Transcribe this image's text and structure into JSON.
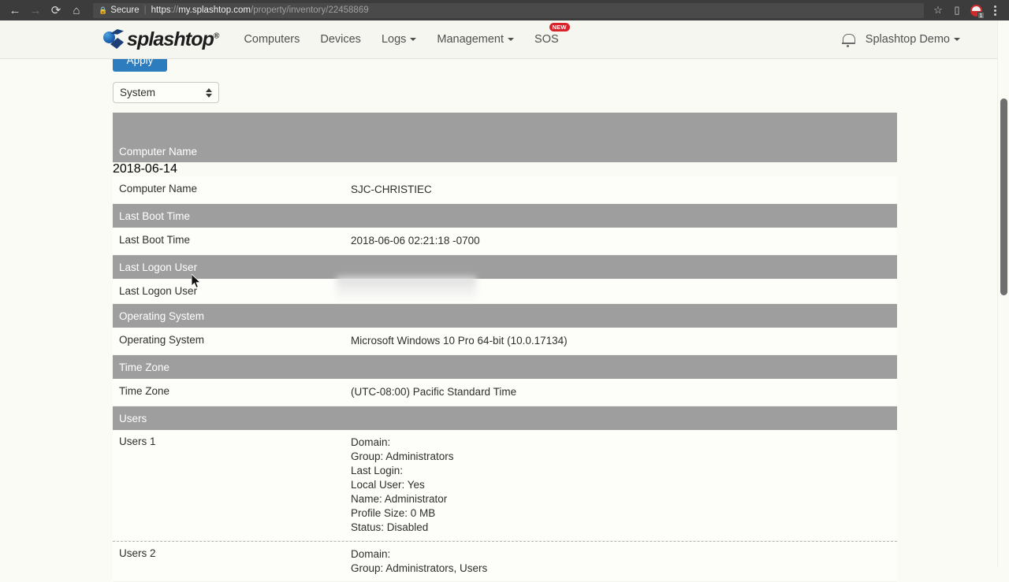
{
  "browser": {
    "back_icon": "back-arrow-icon",
    "forward_icon": "forward-arrow-icon",
    "reload_icon": "reload-icon",
    "home_icon": "home-icon",
    "security_label": "Secure",
    "url_scheme": "https",
    "url_sep": "://",
    "url_host": "my.splashtop.com",
    "url_path": "/property/inventory/22458869",
    "bookmark_icon": "star-icon",
    "cast_icon": "cast-icon",
    "extension_icon": "extension-icon",
    "extension_badge": "1",
    "menu_icon": "kebab-menu-icon"
  },
  "navbar": {
    "brand": "splashtop",
    "brand_sup": "®",
    "links": [
      {
        "label": "Computers",
        "has_caret": false,
        "badge": ""
      },
      {
        "label": "Devices",
        "has_caret": false,
        "badge": ""
      },
      {
        "label": "Logs",
        "has_caret": true,
        "badge": ""
      },
      {
        "label": "Management",
        "has_caret": true,
        "badge": ""
      },
      {
        "label": "SOS",
        "has_caret": false,
        "badge": "NEW"
      }
    ],
    "bell_icon": "notification-bell-icon",
    "account": "Splashtop Demo",
    "account_caret": "chevron-down-icon"
  },
  "toolbar": {
    "apply_label": "Apply",
    "category_selected": "System",
    "category_arrows_icon": "select-stepper-icon"
  },
  "table": {
    "date_column_header": "2018-06-14",
    "sections": [
      {
        "heading": "Computer Name",
        "rows": [
          {
            "label": "Computer Name",
            "value": "SJC-CHRISTIEC"
          }
        ]
      },
      {
        "heading": "Last Boot Time",
        "rows": [
          {
            "label": "Last Boot Time",
            "value": "2018-06-06 02:21:18 -0700"
          }
        ]
      },
      {
        "heading": "Last Logon User",
        "rows": [
          {
            "label": "Last Logon User",
            "value": ""
          }
        ]
      },
      {
        "heading": "Operating System",
        "rows": [
          {
            "label": "Operating System",
            "value": "Microsoft Windows 10 Pro 64-bit (10.0.17134)"
          }
        ]
      },
      {
        "heading": "Time Zone",
        "rows": [
          {
            "label": "Time Zone",
            "value": "(UTC-08:00) Pacific Standard Time"
          }
        ]
      },
      {
        "heading": "Users",
        "rows": [
          {
            "label": "Users 1",
            "value": "Domain:\nGroup: Administrators\nLast Login:\nLocal User: Yes\nName: Administrator\nProfile Size: 0 MB\nStatus: Disabled"
          },
          {
            "label": "Users 2",
            "value": "Domain:\nGroup: Administrators, Users"
          }
        ]
      }
    ]
  },
  "colors": {
    "band_gray": "#9e9e9e",
    "row_bg": "#fdfdfa",
    "page_bg": "#fbfbf5",
    "apply_blue": "#2d7cbd",
    "badge_red": "#d8232a",
    "browser_chrome": "#3c3c3c"
  },
  "cursor": {
    "icon": "mouse-pointer-icon"
  }
}
